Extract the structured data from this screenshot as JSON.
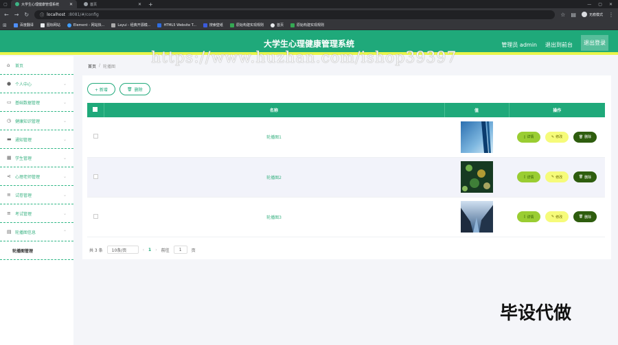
{
  "browser": {
    "tabs": [
      {
        "title": "大学生心理健康管理系统",
        "active": true
      },
      {
        "title": "首页",
        "active": false
      }
    ],
    "url_host": "localhost",
    "url_rest": ":8081/#/config",
    "profile_label": "无痕模式",
    "bookmarks": [
      "百度翻译",
      "图标网站",
      "Element - 网站快...",
      "Layui - 经典开源模...",
      "HTML5 Website T...",
      "搜索壁纸",
      "原始构建实现规则",
      "首页",
      "原始构建实现规则"
    ]
  },
  "header": {
    "title": "大学生心理健康管理系统",
    "user": "管理员 admin",
    "exit_frontend": "退出到前台",
    "logout": "退出登录"
  },
  "sidebar": {
    "items": [
      {
        "label": "首页",
        "icon": "home-icon",
        "has_chevron": false
      },
      {
        "label": "个人中心",
        "icon": "user-icon",
        "has_chevron": true
      },
      {
        "label": "基础数据管理",
        "icon": "doc-icon",
        "has_chevron": true
      },
      {
        "label": "健康知识管理",
        "icon": "clock-icon",
        "has_chevron": true
      },
      {
        "label": "通知管理",
        "icon": "folder-icon",
        "has_chevron": true
      },
      {
        "label": "学生管理",
        "icon": "grid-icon",
        "has_chevron": true
      },
      {
        "label": "心理老师管理",
        "icon": "share-icon",
        "has_chevron": true
      },
      {
        "label": "试卷管理",
        "icon": "list-icon",
        "has_chevron": true
      },
      {
        "label": "考试管理",
        "icon": "list-icon",
        "has_chevron": true
      },
      {
        "label": "轮播图信息",
        "icon": "table-icon",
        "has_chevron": true
      }
    ],
    "sub_item": "轮播图管理"
  },
  "breadcrumb": {
    "home": "首页",
    "sep": "/",
    "current": "轮播图"
  },
  "toolbar": {
    "add": "+ 新增",
    "delete": "删除"
  },
  "table": {
    "headers": [
      "名称",
      "值",
      "操作"
    ],
    "rows": [
      {
        "name": "轮播图1"
      },
      {
        "name": "轮播图2"
      },
      {
        "name": "轮播图3"
      }
    ],
    "actions": {
      "detail": "详情",
      "edit": "修改",
      "delete": "删除"
    }
  },
  "pager": {
    "total": "共 3 条",
    "page_size": "10条/页",
    "prev": "‹",
    "page": "1",
    "next": "›",
    "goto_label": "前往",
    "goto_value": "1",
    "page_unit": "页"
  },
  "watermark": "https://www.huzhan.com/ishop39397",
  "overlay_caption": "毕设代做"
}
